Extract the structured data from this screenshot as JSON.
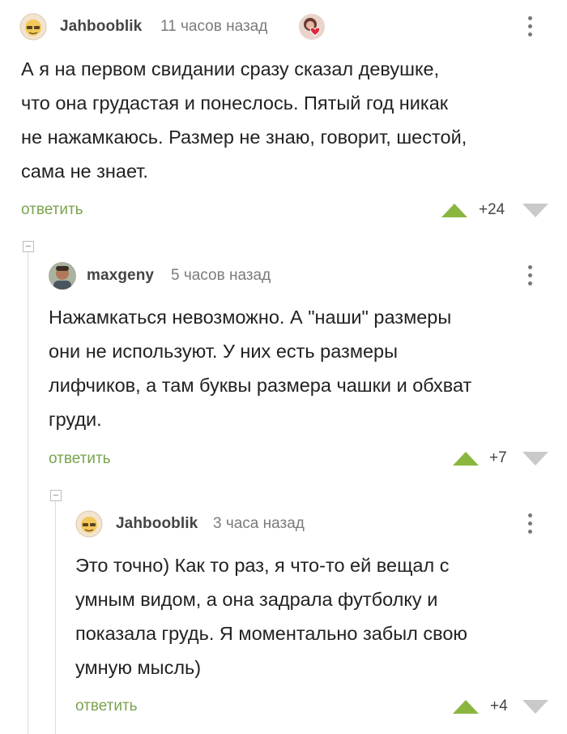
{
  "comments": [
    {
      "username": "Jahbooblik",
      "time": "11 часов назад",
      "text_lines": [
        "А я на первом свидании сразу сказал девушке,",
        "что она грудастая и понеслось. Пятый год никак",
        "не нажамкаюсь. Размер не знаю, говорит, шестой,",
        "сама не знает."
      ],
      "reply_label": "ответить",
      "score": "+24"
    },
    {
      "username": "maxgeny",
      "time": "5 часов назад",
      "text_lines": [
        "Нажамкаться невозможно. А \"наши\" размеры",
        "они не используют. У них есть размеры",
        "лифчиков, а там буквы размера чашки и обхват",
        "груди."
      ],
      "reply_label": "ответить",
      "score": "+7"
    },
    {
      "username": "Jahbooblik",
      "time": "3 часа назад",
      "text_lines": [
        "Это точно) Как то раз, я что-то ей вещал с",
        "умным видом, а она задрала футболку и",
        "показала грудь. Я моментально забыл свою",
        "умную мысль)"
      ],
      "reply_label": "ответить",
      "score": "+4"
    }
  ],
  "colors": {
    "accent": "#7aa34f",
    "upvote": "#8ab640",
    "downvote": "#c9c9c9"
  },
  "icons": [
    "emoji-avatar-icon",
    "user-photo-avatar-icon",
    "heart-badge-icon",
    "kebab-menu-icon",
    "upvote-icon",
    "downvote-icon",
    "collapse-icon"
  ]
}
